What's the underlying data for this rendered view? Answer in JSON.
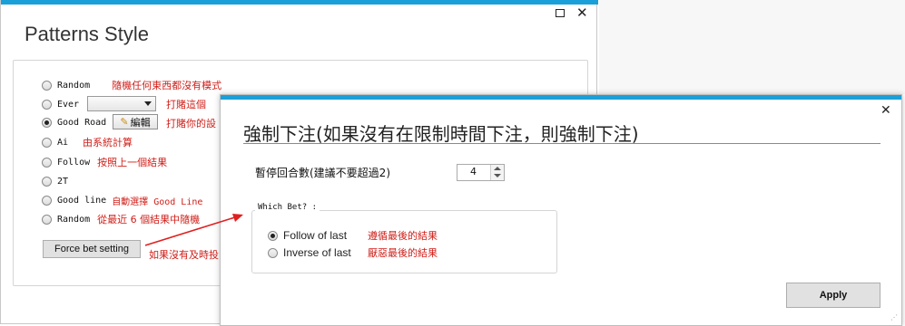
{
  "back_window": {
    "title": "Patterns Style",
    "options": [
      {
        "label": "Random",
        "note": "隨機任何東西都沒有模式",
        "selected": false
      },
      {
        "label": "Ever",
        "note": "打賭這個",
        "selected": false
      },
      {
        "label": "Good Road",
        "note": "打賭你的設",
        "selected": true
      },
      {
        "label": "Ai",
        "note": "由系統計算",
        "selected": false
      },
      {
        "label": "Follow",
        "note": "按照上一個結果",
        "selected": false
      },
      {
        "label": "2T",
        "note": "",
        "selected": false
      },
      {
        "label": "Good line",
        "note": "自動選擇 Good Line",
        "selected": false
      },
      {
        "label": "Random",
        "note": "從最近 6 個結果中隨機",
        "selected": false
      }
    ],
    "edit_button_label": "編輯",
    "force_bet_button_label": "Force bet setting",
    "force_bet_note": "如果沒有及時投"
  },
  "dialog": {
    "title": "強制下注(如果沒有在限制時間下注，則強制下注)",
    "pause_label": "暫停回合數(建議不要超過2)",
    "pause_value": "4",
    "which_bet_legend": "Which Bet? :",
    "bet_options": [
      {
        "label": "Follow of last",
        "note": "遵循最後的結果",
        "selected": true
      },
      {
        "label": "Inverse of last",
        "note": "厭惡最後的結果",
        "selected": false
      }
    ],
    "apply_label": "Apply"
  },
  "icons": {
    "back_maximize": "maximize-icon",
    "back_close": "close-icon",
    "dialog_close": "close-icon",
    "edit": "pencil-icon",
    "arrow": "annotation-arrow"
  },
  "colors": {
    "accent": "#1aa0d8",
    "note_red": "#d0201a",
    "arrow_red": "#e02020"
  }
}
